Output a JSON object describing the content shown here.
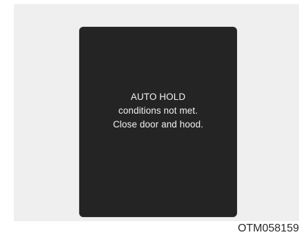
{
  "display": {
    "message_lines": [
      "AUTO HOLD",
      "conditions not met.",
      "Close door and hood."
    ]
  },
  "figure_code": "OTM058159",
  "colors": {
    "panel_background": "#efefef",
    "screen_background": "#242424",
    "message_text": "#f2f2f2"
  }
}
